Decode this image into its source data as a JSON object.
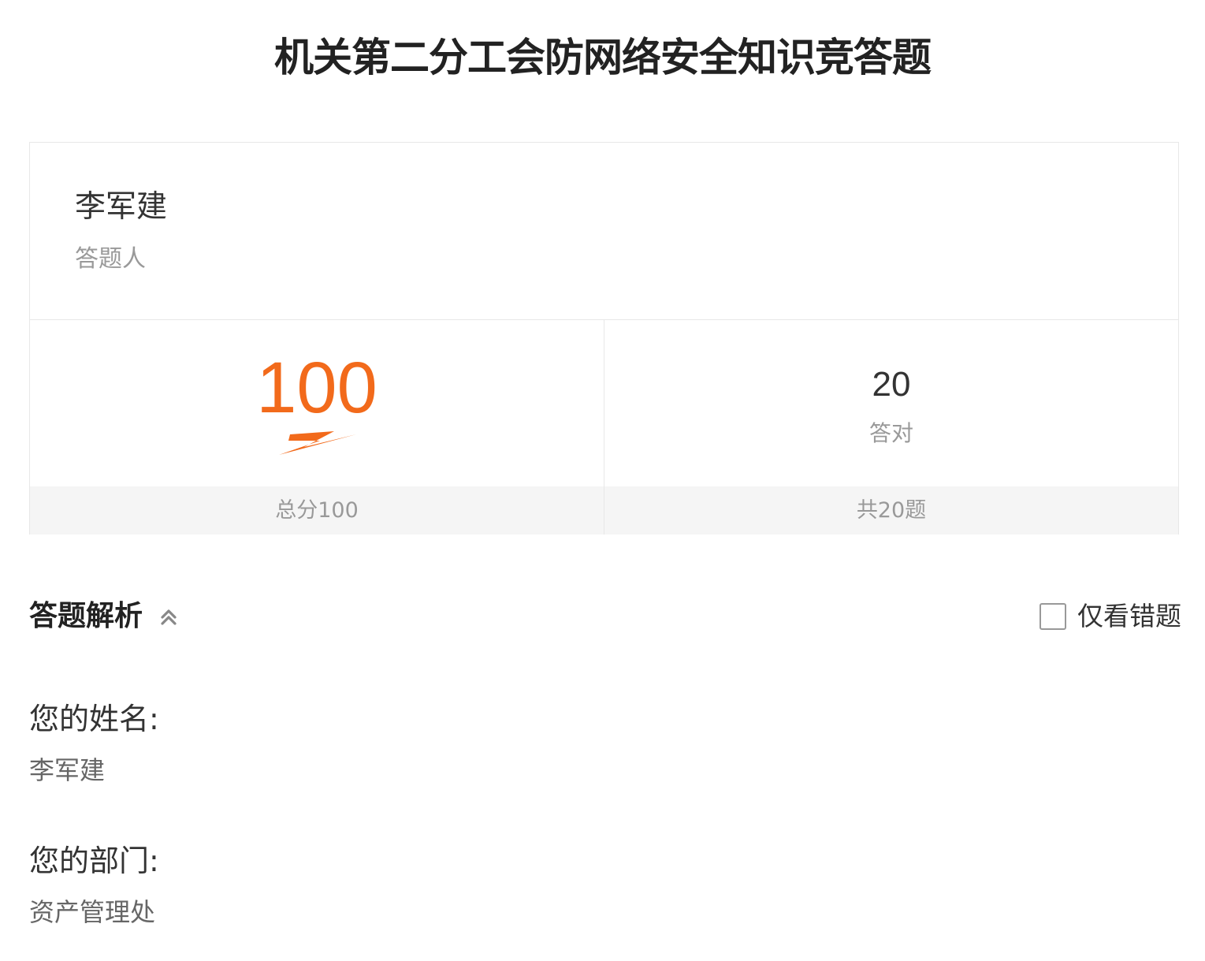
{
  "page": {
    "title": "机关第二分工会防网络安全知识竞答题"
  },
  "result": {
    "respondent_name": "李军建",
    "respondent_caption": "答题人",
    "score": "100",
    "total_score_label": "总分100",
    "correct_count": "20",
    "correct_caption": "答对",
    "total_questions_label": "共20题"
  },
  "analysis": {
    "title": "答题解析",
    "collapse_icon": "chevron-double-up-icon",
    "wrong_only_label": "仅看错题",
    "wrong_only_checked": false
  },
  "answers": [
    {
      "question": "您的姓名:",
      "answer": "李军建"
    },
    {
      "question": "您的部门:",
      "answer": "资产管理处"
    }
  ],
  "colors": {
    "accent": "#f26a1b",
    "muted_text": "#999999",
    "border": "#e8e8e8",
    "footer_bg": "#f5f5f5"
  }
}
